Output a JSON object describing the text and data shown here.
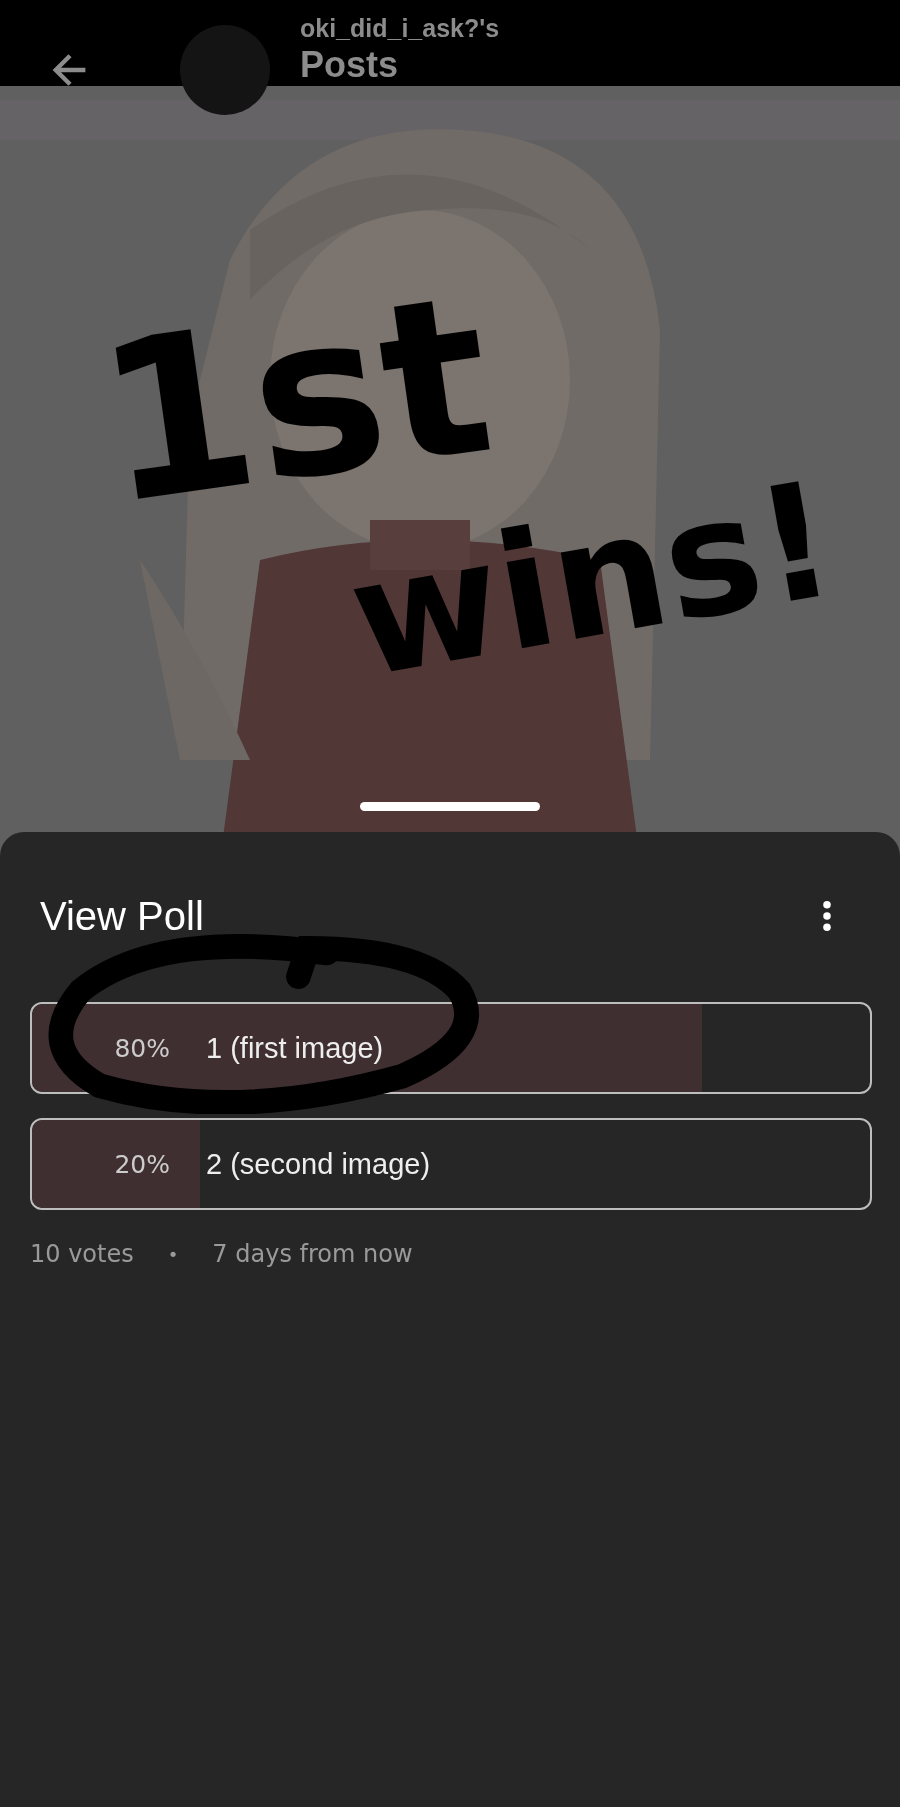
{
  "header": {
    "username": "oki_did_i_ask?'s",
    "title": "Posts"
  },
  "annotation_lines": [
    "1st",
    "wins!"
  ],
  "poll": {
    "title": "View Poll",
    "options": [
      {
        "percent": "80%",
        "label": "1 (first image)",
        "level": 0.8,
        "circled": true
      },
      {
        "percent": "20%",
        "label": "2 (second image)",
        "level": 0.2,
        "circled": false
      }
    ],
    "votes": "10 votes",
    "separator": "•",
    "ends": "7 days from now"
  }
}
